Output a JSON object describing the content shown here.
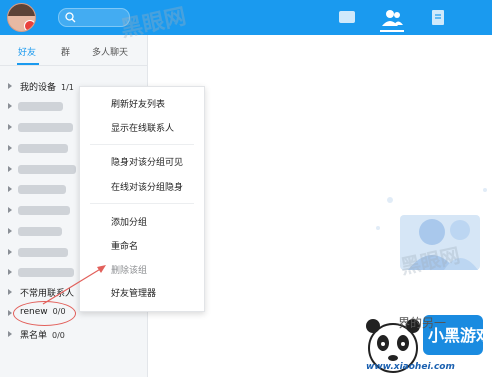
{
  "colors": {
    "accent": "#1a9aef",
    "annotation": "#e2605b",
    "panel_bg": "#f4f6f8"
  },
  "topbar": {
    "icons": [
      "chat-icon",
      "contacts-icon",
      "document-icon"
    ],
    "active_icon": "contacts-icon"
  },
  "tabs": [
    "好友",
    "群",
    "多人聊天"
  ],
  "groups": {
    "my_devices": {
      "label": "我的设备",
      "count": "1/1"
    },
    "uncommon": {
      "label": "不常用联系人"
    },
    "renew": {
      "label": "renew",
      "count": "0/0"
    },
    "blacklist": {
      "label": "黑名单",
      "count": "0/0"
    }
  },
  "menu": {
    "refresh": "刷新好友列表",
    "show_online": "显示在线联系人",
    "invisible_visible": "隐身对该分组可见",
    "online_invisible": "在线对该分组隐身",
    "add_group": "添加分组",
    "rename": "重命名",
    "delete_group": "删除该组",
    "friend_manager": "好友管理器"
  },
  "watermark": {
    "text": "黑眼网",
    "partial_text": "界的另一",
    "site": "www.xiaohei.com",
    "brand": "小黑游戏"
  }
}
